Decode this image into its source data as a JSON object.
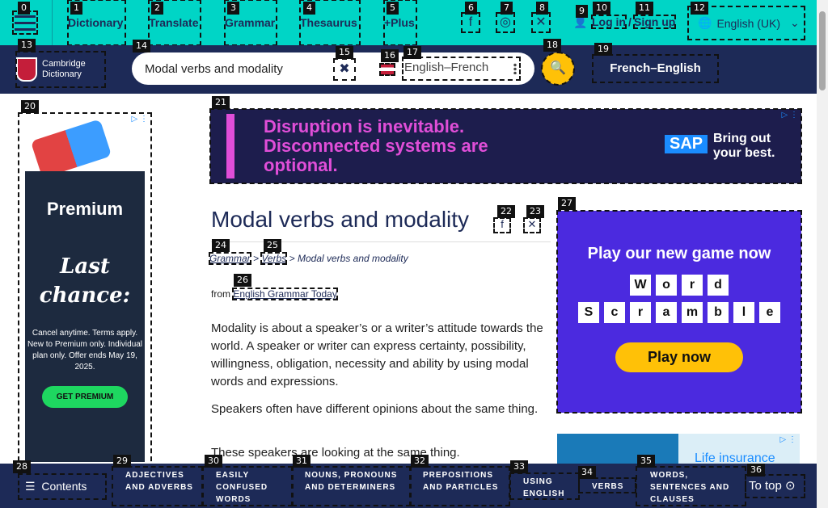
{
  "topnav": {
    "items": [
      "Dictionary",
      "Translate",
      "Grammar",
      "Thesaurus",
      "+Plus"
    ],
    "login_label": "Log in",
    "separator": "/",
    "signup_label": "Sign up",
    "language": "English (UK)"
  },
  "header": {
    "logo_line1": "Cambridge",
    "logo_line2": "Dictionary",
    "search_value": "Modal verbs and modality",
    "dictionary_select": "English–French",
    "alt_dictionary": "French–English"
  },
  "ads": {
    "left": {
      "brand": "Premium",
      "headline": "Last chance:",
      "fine_print": "Cancel anytime. Terms apply. New to Premium only. Individual plan only. Offer ends May 19, 2025.",
      "cta": "GET PREMIUM"
    },
    "top": {
      "message": "Disruption is inevitable. Disconnected systems are optional.",
      "brand": "SAP",
      "tagline": "Bring out your best."
    },
    "game": {
      "title": "Play our new game now",
      "row1": [
        "W",
        "o",
        "r",
        "d"
      ],
      "row2": [
        "S",
        "c",
        "r",
        "a",
        "m",
        "b",
        "l",
        "e"
      ],
      "cta": "Play now"
    },
    "life": {
      "text": "Life insurance"
    }
  },
  "article": {
    "title": "Modal verbs and modality",
    "breadcrumb": [
      "Grammar",
      "Verbs",
      "Modal verbs and modality"
    ],
    "breadcrumb_sep": ">",
    "from_label": "from",
    "source": "English Grammar Today",
    "paragraphs": [
      "Modality  is about a speaker’s or a writer’s attitude towards the world. A speaker or writer can express certainty, possibility, willingness, obligation, necessity and ability by using modal words and expressions.",
      "Speakers often have different opinions about the same thing.",
      "These speakers are looking at the same thing."
    ]
  },
  "bottombar": {
    "contents_label": "Contents",
    "items": [
      "ADJECTIVES AND ADVERBS",
      "EASILY CONFUSED WORDS",
      "NOUNS, PRONOUNS AND DETERMINERS",
      "PREPOSITIONS AND PARTICLES",
      "USING ENGLISH",
      "VERBS",
      "WORDS, SENTENCES AND CLAUSES"
    ],
    "to_top_label": "To top"
  },
  "badges": [
    "0",
    "1",
    "2",
    "3",
    "4",
    "5",
    "6",
    "7",
    "8",
    "9",
    "10",
    "11",
    "12",
    "13",
    "14",
    "15",
    "16",
    "17",
    "18",
    "19",
    "20",
    "21",
    "22",
    "23",
    "24",
    "25",
    "26",
    "27",
    "28",
    "29",
    "30",
    "31",
    "32",
    "33",
    "34",
    "35",
    "36"
  ],
  "colors": {
    "accent": "#00d5c6",
    "navy": "#1d2a57",
    "cta": "#ffc107"
  }
}
